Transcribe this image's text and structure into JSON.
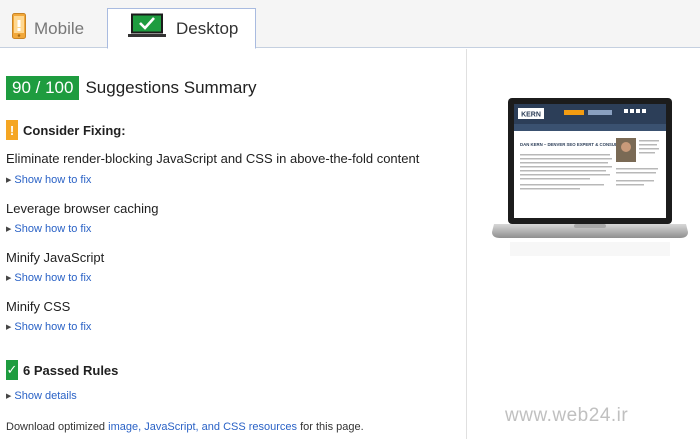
{
  "tabs": {
    "mobile_label": "Mobile",
    "desktop_label": "Desktop"
  },
  "score": {
    "value": "90 / 100",
    "title": "Suggestions Summary",
    "badge_color": "#1e9c3f"
  },
  "consider_fixing": {
    "icon": "warning-icon",
    "title": "Consider Fixing:",
    "rules": [
      {
        "title": "Eliminate render-blocking JavaScript and CSS in above-the-fold content",
        "link": "Show how to fix"
      },
      {
        "title": "Leverage browser caching",
        "link": "Show how to fix"
      },
      {
        "title": "Minify JavaScript",
        "link": "Show how to fix"
      },
      {
        "title": "Minify CSS",
        "link": "Show how to fix"
      }
    ]
  },
  "passed": {
    "icon": "check-icon",
    "title": "6 Passed Rules",
    "link": "Show details"
  },
  "footer": {
    "prefix": "Download optimized ",
    "link": "image, JavaScript, and CSS resources",
    "suffix": " for this page."
  },
  "preview": {
    "site_logo": "KERN",
    "headline": "DAN KERN – DENVER SEO EXPERT & CONSULTANT"
  },
  "watermark": "www.web24.ir",
  "colors": {
    "link": "#2a62c6",
    "warning": "#f5a623",
    "pass": "#1e9c3f"
  }
}
